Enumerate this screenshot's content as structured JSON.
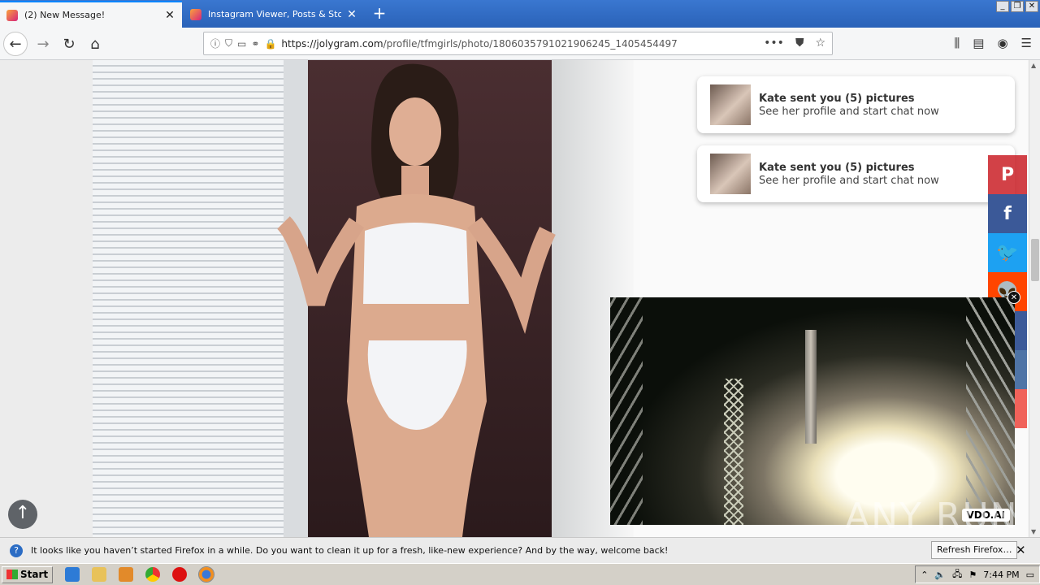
{
  "tabs": [
    {
      "title": "(2) New Message!",
      "active": true
    },
    {
      "title": "Instagram Viewer, Posts & Story ",
      "active": false
    }
  ],
  "nav": {
    "url_host": "https://jolygram.com",
    "url_path": "/profile/tfmgirls/photo/1806035791021906245_1405454497",
    "icons": [
      "back-icon",
      "forward-icon",
      "reload-icon",
      "home-icon"
    ],
    "url_icons": [
      "info-icon",
      "shield-icon",
      "permissions-icon",
      "link-icon",
      "lock-icon"
    ],
    "url_right": [
      "page-actions-icon",
      "pocket-icon",
      "bookmark-star-icon"
    ],
    "toolbar_right": [
      "library-icon",
      "sidebar-icon",
      "account-icon",
      "menu-icon"
    ]
  },
  "notifications": [
    {
      "title": "Kate sent you (5) pictures",
      "subtitle": "See her profile and start chat now"
    },
    {
      "title": "Kate sent you (5) pictures",
      "subtitle": "See her profile and start chat now"
    }
  ],
  "share": [
    {
      "label": "P",
      "icon": "pinterest-icon",
      "color": "#cb2027"
    },
    {
      "label": "f",
      "icon": "facebook-icon",
      "color": "#3b5998"
    },
    {
      "label": "🐦",
      "icon": "twitter-icon",
      "color": "#1da1f2"
    },
    {
      "label": "👽",
      "icon": "reddit-icon",
      "color": "#ff4500"
    },
    {
      "label": "",
      "icon": "share-icon",
      "color": "#3c5a99"
    },
    {
      "label": "",
      "icon": "share-icon",
      "color": "#4f74a6"
    },
    {
      "label": "",
      "icon": "share-icon",
      "color": "#f0625a"
    }
  ],
  "video": {
    "brand": "VDO.AI"
  },
  "notification_bar": {
    "message": "It looks like you haven’t started Firefox in a while. Do you want to clean it up for a fresh, like-new experience? And by the way, welcome back!",
    "button": "Refresh Firefox…"
  },
  "taskbar": {
    "start": "Start",
    "time": "7:44 PM"
  },
  "watermark": "ANY RUN"
}
